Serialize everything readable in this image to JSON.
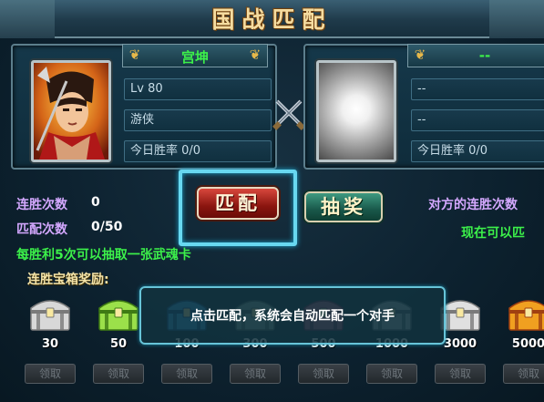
{
  "title": "国战匹配",
  "player": {
    "name": "宫坤",
    "level": "Lv 80",
    "job": "游侠",
    "today_winrate": "今日胜率 0/0"
  },
  "opponent": {
    "name": "--",
    "field1": "--",
    "field2": "--",
    "today_winrate": "今日胜率 0/0"
  },
  "buttons": {
    "match": "匹配",
    "lottery": "抽奖"
  },
  "stats": {
    "win_streak_label": "连胜次数",
    "win_streak_value": "0",
    "match_count_label": "匹配次数",
    "match_count_value": "0/50",
    "opponent_streak": "对方的连胜次数",
    "now_can": "现在可以匹"
  },
  "info_line": "每胜利5次可以抽取一张武魂卡",
  "rewards": {
    "title": "连胜宝箱奖励:",
    "claim_label": "领取",
    "chests": [
      {
        "count": "30",
        "color": "#d8d8d8",
        "trim": "#7a7a7a"
      },
      {
        "count": "50",
        "color": "#9be04a",
        "trim": "#3e7a14"
      },
      {
        "count": "100",
        "color": "#3aa8e8",
        "trim": "#14508a"
      },
      {
        "count": "300",
        "color": "#8aa8a0",
        "trim": "#4a6060"
      },
      {
        "count": "500",
        "color": "#c06080",
        "trim": "#6a2040"
      },
      {
        "count": "1000",
        "color": "#a0b0b8",
        "trim": "#506068"
      },
      {
        "count": "3000",
        "color": "#e0e0e0",
        "trim": "#7a7a7a"
      },
      {
        "count": "5000",
        "color": "#f0a020",
        "trim": "#a04010"
      }
    ]
  },
  "tooltip": "点击匹配，系统会自动匹配一个对手"
}
